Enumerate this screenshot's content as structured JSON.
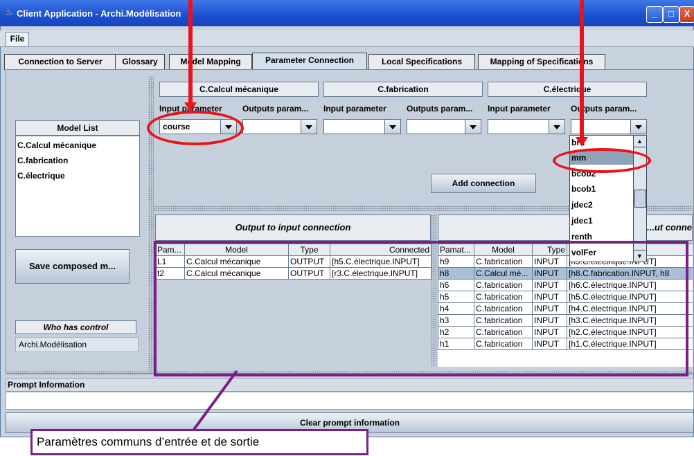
{
  "window": {
    "title": "Client Application - Archi.Modélisation"
  },
  "menu": {
    "file": "File"
  },
  "tabs": [
    "Connection to Server",
    "Glossary",
    "Model Mapping",
    "Parameter Connection",
    "Local Specifications",
    "Mapping of Specifications"
  ],
  "left": {
    "model_list_header": "Model List",
    "models": [
      "C.Calcul mécanique",
      "C.fabrication",
      "C.électrique"
    ],
    "save_button": "Save composed m...",
    "control_header": "Who has control",
    "control_value": "Archi.Modélisation"
  },
  "models_panel": {
    "groups": [
      {
        "name": "C.Calcul mécanique",
        "input_label": "Input parameter",
        "output_label": "Outputs param...",
        "input_value": "course",
        "output_value": ""
      },
      {
        "name": "C.fabrication",
        "input_label": "Input parameter",
        "output_label": "Outputs param...",
        "input_value": "",
        "output_value": ""
      },
      {
        "name": "C.électrique",
        "input_label": "Input parameter",
        "output_label": "Outputs param...",
        "input_value": "",
        "output_value": ""
      }
    ],
    "add_button": "Add connection"
  },
  "dropdown": {
    "items": [
      "bru",
      "mm",
      "bcob2",
      "bcob1",
      "jdec2",
      "jdec1",
      "renth",
      "volFer"
    ],
    "selected": "mm"
  },
  "output_table": {
    "title": "Output to input connection",
    "columns": [
      "Pam...",
      "Model",
      "Type",
      "Connected"
    ],
    "rows": [
      [
        "L1",
        "C.Calcul mécanique",
        "OUTPUT",
        "[h5.C.électrique.INPUT]"
      ],
      [
        "t2",
        "C.Calcul mécanique",
        "OUTPUT",
        "[r3.C.électrique.INPUT]"
      ]
    ]
  },
  "input_table": {
    "title": "...ut conne",
    "columns": [
      "Pamat...",
      "Model",
      "Type",
      ""
    ],
    "rows": [
      [
        "h9",
        "C.fabrication",
        "INPUT",
        "[h9.C.électrique.INPUT]"
      ],
      [
        "h8",
        "C.Calcul mé...",
        "INPUT",
        "[h8.C.fabrication.INPUT, h8"
      ],
      [
        "h6",
        "C.fabrication",
        "INPUT",
        "[h6.C.électrique.INPUT]"
      ],
      [
        "h5",
        "C.fabrication",
        "INPUT",
        "[h5.C.électrique.INPUT]"
      ],
      [
        "h4",
        "C.fabrication",
        "INPUT",
        "[h4.C.électrique.INPUT]"
      ],
      [
        "h3",
        "C.fabrication",
        "INPUT",
        "[h3.C.électrique.INPUT]"
      ],
      [
        "h2",
        "C.fabrication",
        "INPUT",
        "[h2.C.électrique.INPUT]"
      ],
      [
        "h1",
        "C.fabrication",
        "INPUT",
        "[h1.C.électrique.INPUT]"
      ]
    ]
  },
  "prompt": {
    "header": "Prompt Information",
    "clear_button": "Clear prompt information"
  },
  "annotation": {
    "caption": "Paramètres communs d’entrée et de sortie"
  },
  "colors": {
    "annotation_red": "#e8141b",
    "annotation_purple": "#7a1f85",
    "title_blue": "#1b4fd0"
  }
}
